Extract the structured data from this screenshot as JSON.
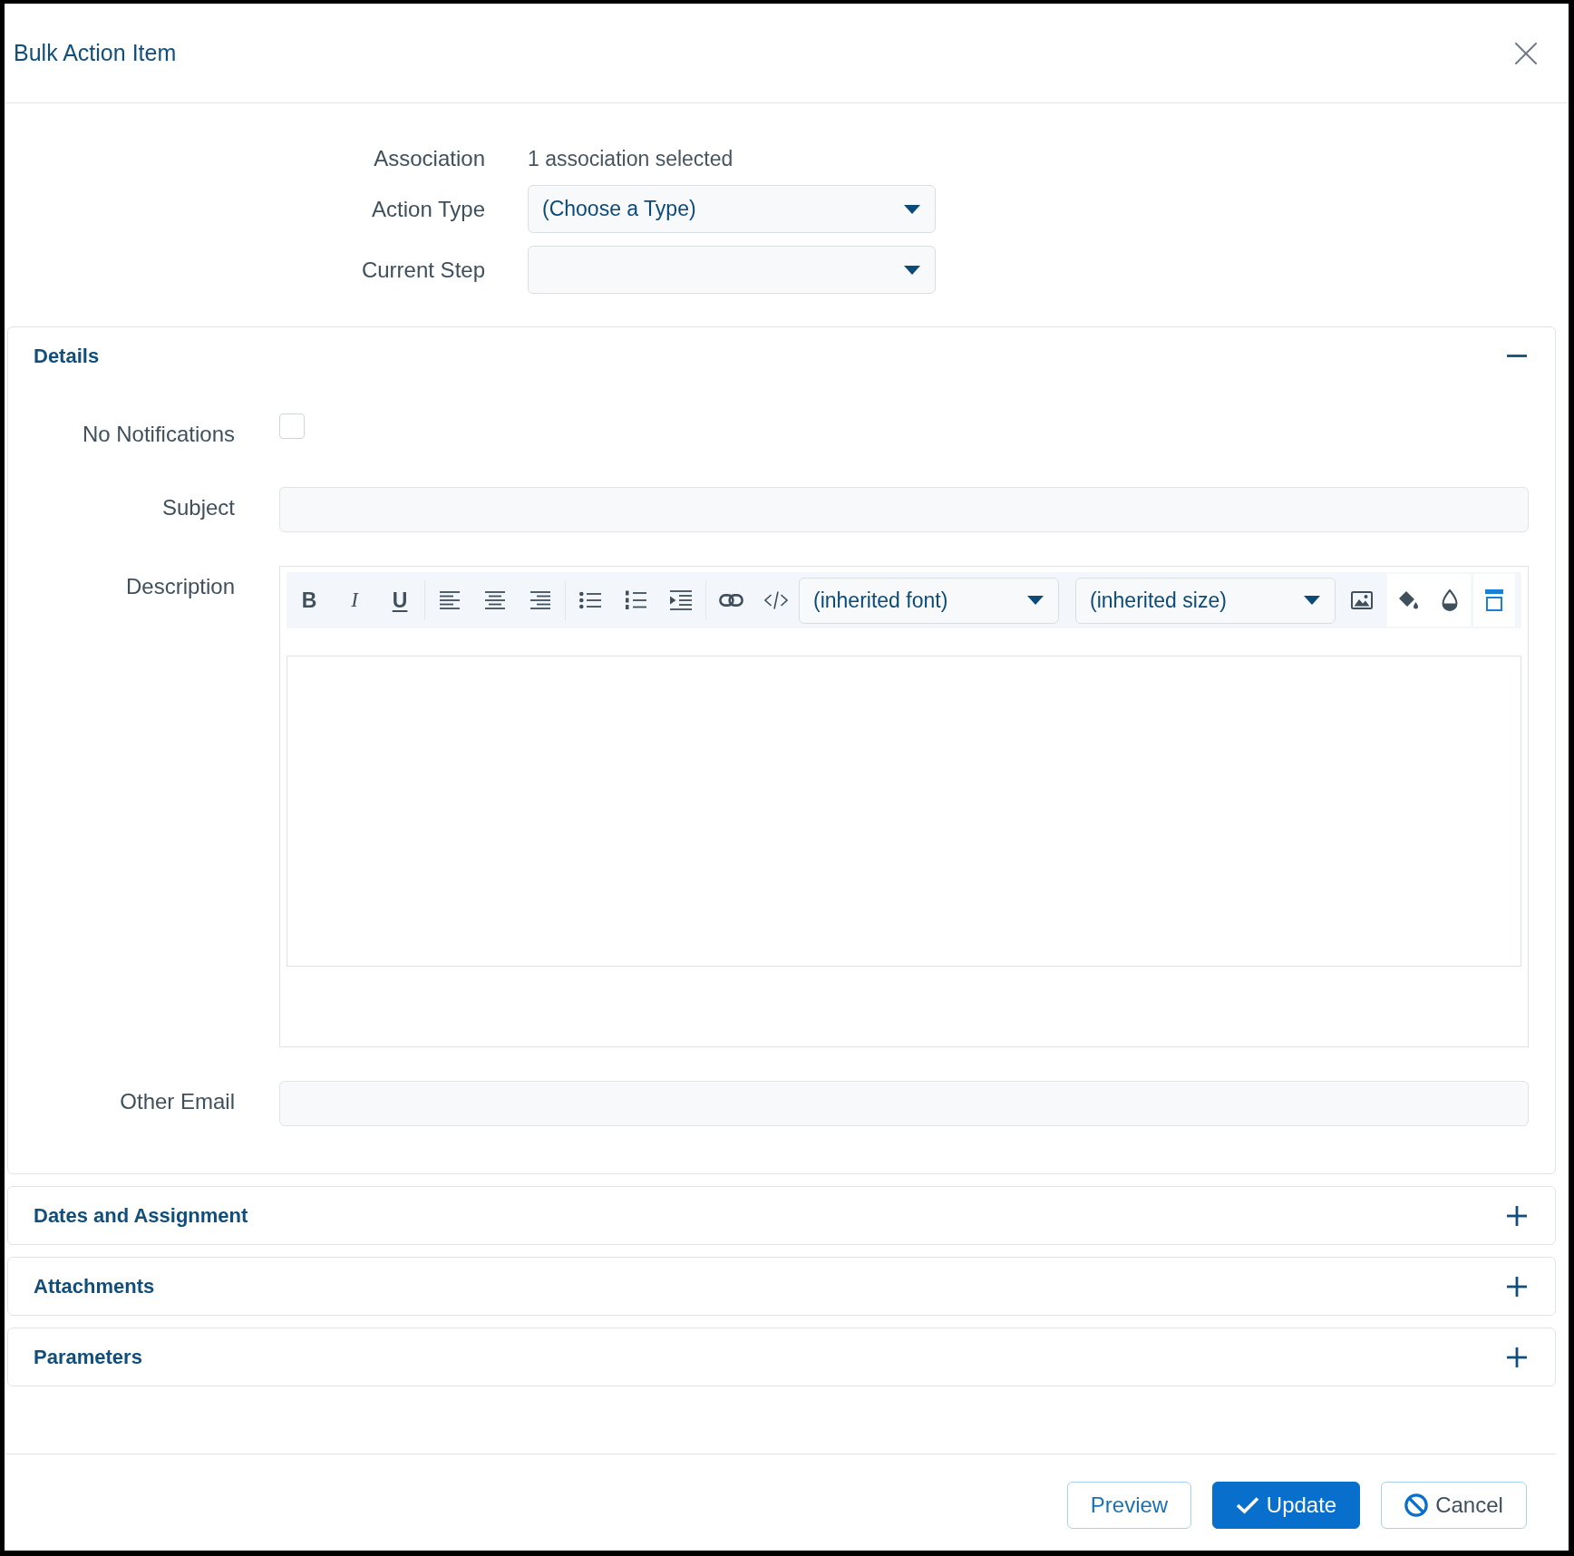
{
  "dialog": {
    "title": "Bulk Action Item"
  },
  "form": [
    {
      "kind": "text",
      "label": "Association",
      "value": "1 association selected"
    },
    {
      "kind": "select",
      "label": "Action Type",
      "value": "(Choose a Type)"
    },
    {
      "kind": "select",
      "label": "Current Step"
    }
  ],
  "sections": [
    {
      "title": "Details",
      "expanded": true,
      "fields": [
        {
          "kind": "checkbox",
          "label": "No Notifications",
          "checked": false
        },
        {
          "kind": "input",
          "label": "Subject"
        },
        {
          "kind": "editor",
          "label": "Description",
          "toolbar": [
            {
              "kind": "plain",
              "items": [
                {
                  "kind": "bold",
                  "label": "B"
                },
                {
                  "kind": "italic",
                  "label": "I"
                },
                {
                  "kind": "underline",
                  "label": "U"
                }
              ]
            },
            {
              "kind": "plain",
              "items": [
                {
                  "kind": "align-left"
                },
                {
                  "kind": "align-center"
                },
                {
                  "kind": "align-right"
                }
              ]
            },
            {
              "kind": "plain",
              "items": [
                {
                  "kind": "bullet-list"
                },
                {
                  "kind": "numbered-list"
                },
                {
                  "kind": "indent"
                }
              ]
            },
            {
              "kind": "plain",
              "items": [
                {
                  "kind": "link"
                },
                {
                  "kind": "code"
                }
              ]
            },
            {
              "kind": "selects",
              "items": [
                {
                  "kind": "select",
                  "value": "(inherited font)"
                },
                {
                  "kind": "select",
                  "value": "(inherited size)"
                }
              ]
            },
            {
              "kind": "bare",
              "items": [
                {
                  "kind": "image"
                }
              ]
            },
            {
              "kind": "tile",
              "items": [
                {
                  "kind": "fill-color"
                },
                {
                  "kind": "text-color"
                }
              ]
            },
            {
              "kind": "tile",
              "items": [
                {
                  "kind": "fullscreen"
                }
              ]
            }
          ]
        },
        {
          "kind": "input",
          "label": "Other Email"
        }
      ]
    },
    {
      "title": "Dates and Assignment",
      "expanded": false
    },
    {
      "title": "Attachments",
      "expanded": false
    },
    {
      "title": "Parameters",
      "expanded": false
    }
  ],
  "footer": {
    "buttons": [
      {
        "kind": "secondary",
        "label": "Preview"
      },
      {
        "kind": "primary",
        "label": "Update"
      },
      {
        "kind": "cancel",
        "label": "Cancel"
      }
    ]
  }
}
